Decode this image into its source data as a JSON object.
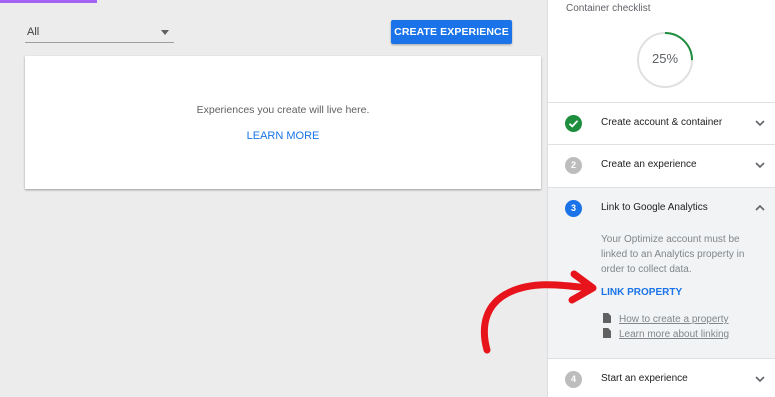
{
  "filter": {
    "value": "All"
  },
  "toolbar": {
    "create_label": "CREATE EXPERIENCE"
  },
  "empty_card": {
    "message": "Experiences you create will live here.",
    "link": "LEARN MORE"
  },
  "checklist": {
    "title": "Container checklist",
    "progress_percent": 25,
    "progress_label": "25%",
    "steps": [
      {
        "number": "1",
        "label": "Create account & container",
        "status": "done"
      },
      {
        "number": "2",
        "label": "Create an experience",
        "status": "pending"
      },
      {
        "number": "3",
        "label": "Link to Google Analytics",
        "status": "active",
        "description": "Your Optimize account must be linked to an Analytics property in order to collect data.",
        "action": "LINK PROPERTY",
        "docs": [
          "How to create a property",
          "Learn more about linking"
        ]
      },
      {
        "number": "4",
        "label": "Start an experience",
        "status": "pending"
      }
    ]
  },
  "colors": {
    "accent": "#1a73e8",
    "success": "#1e8e3e",
    "annotation": "#e8141c"
  }
}
